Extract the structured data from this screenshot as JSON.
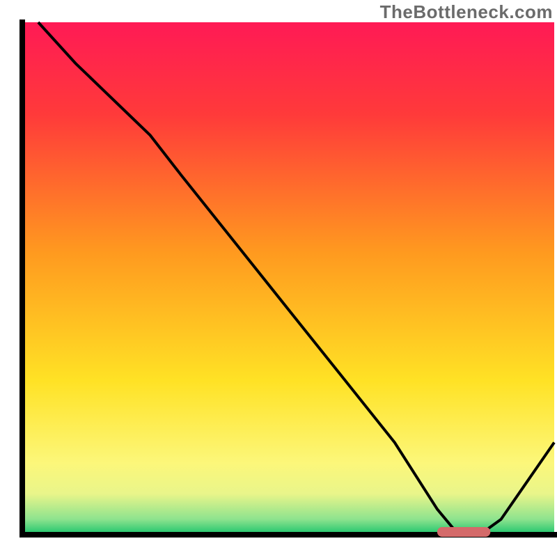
{
  "watermark": "TheBottleneck.com",
  "chart_data": {
    "type": "line",
    "title": "",
    "xlabel": "",
    "ylabel": "",
    "xlim": [
      0,
      100
    ],
    "ylim": [
      0,
      100
    ],
    "x": [
      3,
      10,
      20,
      24,
      30,
      40,
      50,
      60,
      70,
      78,
      82,
      86,
      90,
      100
    ],
    "values": [
      100,
      92,
      82,
      78,
      70,
      57,
      44,
      31,
      18,
      5,
      0,
      0,
      3,
      18
    ],
    "sweet_spot": {
      "x_start": 78,
      "x_end": 88,
      "y": 0
    },
    "background_gradient_stops": [
      {
        "pos": 0.0,
        "color": "#ff1a55"
      },
      {
        "pos": 0.18,
        "color": "#ff3a3a"
      },
      {
        "pos": 0.45,
        "color": "#ff9a1f"
      },
      {
        "pos": 0.7,
        "color": "#ffe225"
      },
      {
        "pos": 0.86,
        "color": "#fcf77a"
      },
      {
        "pos": 0.92,
        "color": "#e9f58a"
      },
      {
        "pos": 0.97,
        "color": "#8de38e"
      },
      {
        "pos": 1.0,
        "color": "#19c36b"
      }
    ],
    "axis_color": "#000000",
    "line_color": "#000000",
    "marker_color": "#d46a6a"
  }
}
